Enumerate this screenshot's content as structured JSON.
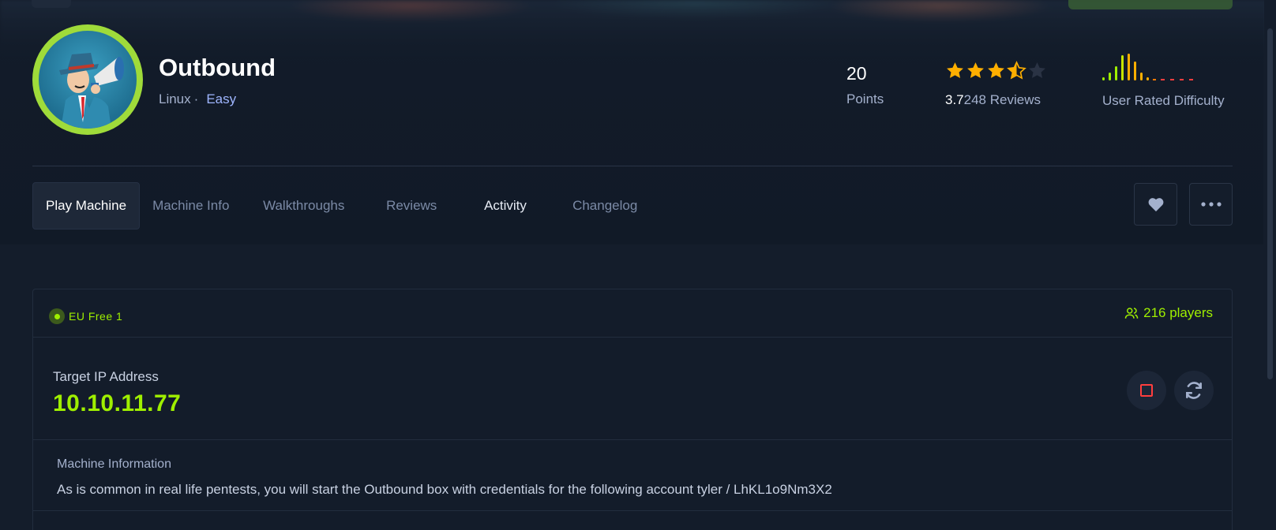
{
  "machine": {
    "name": "Outbound",
    "os": "Linux",
    "separator": "·",
    "difficulty": "Easy"
  },
  "stats": {
    "points_value": "20",
    "points_label": "Points",
    "rating_score": "3.7",
    "rating_reviews": "248 Reviews",
    "rating_stars": 3.5,
    "user_difficulty_label": "User Rated Difficulty"
  },
  "tabs": [
    {
      "label": "Play Machine"
    },
    {
      "label": "Machine Info"
    },
    {
      "label": "Walkthroughs"
    },
    {
      "label": "Reviews"
    },
    {
      "label": "Activity"
    },
    {
      "label": "Changelog"
    }
  ],
  "server": {
    "name": "EU Free 1",
    "players": "216 players"
  },
  "target": {
    "label": "Target IP Address",
    "ip": "10.10.11.77"
  },
  "info": {
    "title": "Machine Information",
    "text": "As is common in real life pentests, you will start the Outbound box with credentials for the following account tyler / LhKL1o9Nm3X2"
  },
  "colors": {
    "accent_green": "#9fef00",
    "star_orange": "#ffaf00",
    "stop_red": "#ff3e3e",
    "background": "#141d2b"
  },
  "icons": [
    "heart-icon",
    "more-icon",
    "stop-icon",
    "refresh-icon",
    "users-icon",
    "star-icon"
  ]
}
